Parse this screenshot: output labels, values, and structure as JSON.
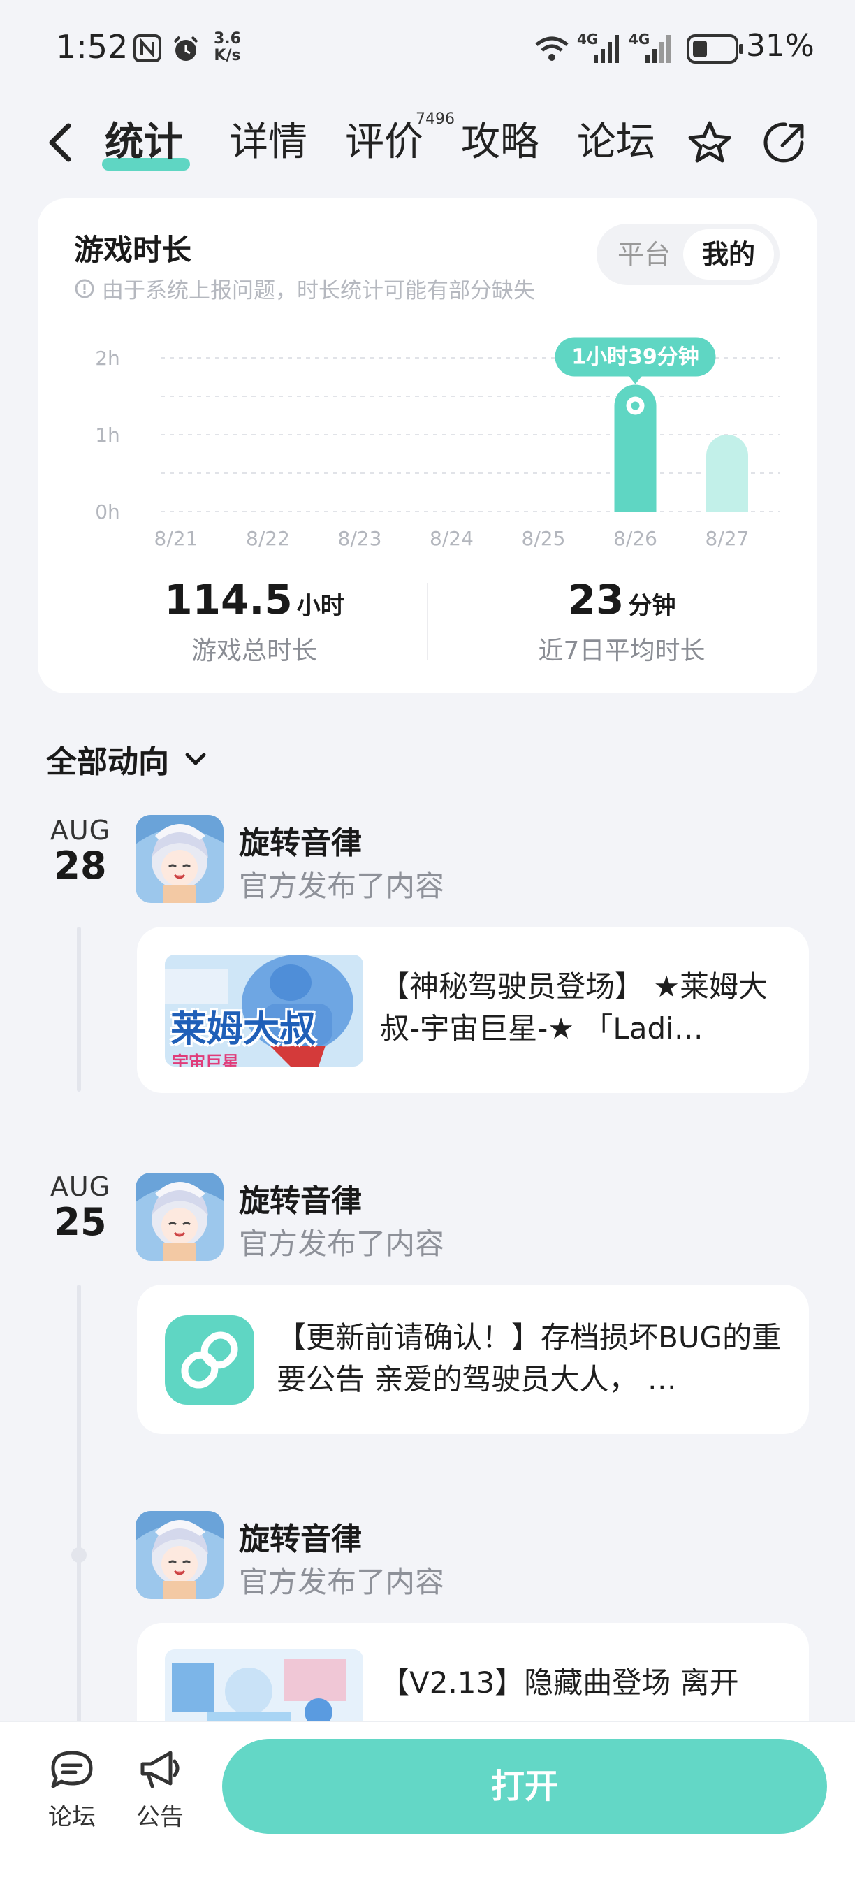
{
  "status_bar": {
    "time": "1:52",
    "net_speed_value": "3.6",
    "net_speed_unit": "K/s",
    "battery": "31%",
    "signal_label_1": "4G",
    "signal_label_2": "4G"
  },
  "nav": {
    "tabs": [
      {
        "label": "统计",
        "active": true
      },
      {
        "label": "详情",
        "active": false
      },
      {
        "label": "评价",
        "active": false
      },
      {
        "label": "攻略",
        "active": false
      },
      {
        "label": "论坛",
        "active": false
      }
    ],
    "review_count": "7496",
    "icons": [
      "back-icon",
      "star-icon",
      "share-icon"
    ]
  },
  "stats": {
    "title": "游戏时长",
    "note": "由于系统上报问题，时长统计可能有部分缺失",
    "toggle": {
      "platform": "平台",
      "mine": "我的",
      "selected": "mine"
    },
    "total_value": "114.5",
    "total_unit": "小时",
    "total_label": "游戏总时长",
    "avg_value": "23",
    "avg_unit": "分钟",
    "avg_label": "近7日平均时长",
    "accent_color": "#5fd6c3",
    "light_color": "#c2f0e9"
  },
  "chart_data": {
    "type": "bar",
    "categories": [
      "8/21",
      "8/22",
      "8/23",
      "8/24",
      "8/25",
      "8/26",
      "8/27"
    ],
    "values": [
      0,
      0,
      0,
      0,
      0,
      1.65,
      1.0
    ],
    "y_ticks": [
      "0h",
      "1h",
      "2h"
    ],
    "ylim": [
      0,
      2
    ],
    "highlight_index": 5,
    "highlight_label": "1小时39分钟",
    "grid": true
  },
  "feed": {
    "header": "全部动向",
    "posts": [
      {
        "month": "AUG",
        "day": "28",
        "name": "旋转音律",
        "action": "官方发布了内容",
        "text": "【神秘驾驶员登场】 ★莱姆大叔-宇宙巨星-★ 「Ladi…",
        "thumb_text": "莱姆大叔",
        "thumb_sub": "宇宙巨星"
      },
      {
        "month": "AUG",
        "day": "25",
        "name": "旋转音律",
        "action": "官方发布了内容",
        "text": "【更新前请确认！】存档损坏BUG的重要公告 亲爱的驾驶员大人， …"
      },
      {
        "name": "旋转音律",
        "action": "官方发布了内容",
        "text": "【V2.13】隐藏曲登场 离开"
      }
    ]
  },
  "bottom": {
    "forum_label": "论坛",
    "notice_label": "公告",
    "open_label": "打开"
  }
}
